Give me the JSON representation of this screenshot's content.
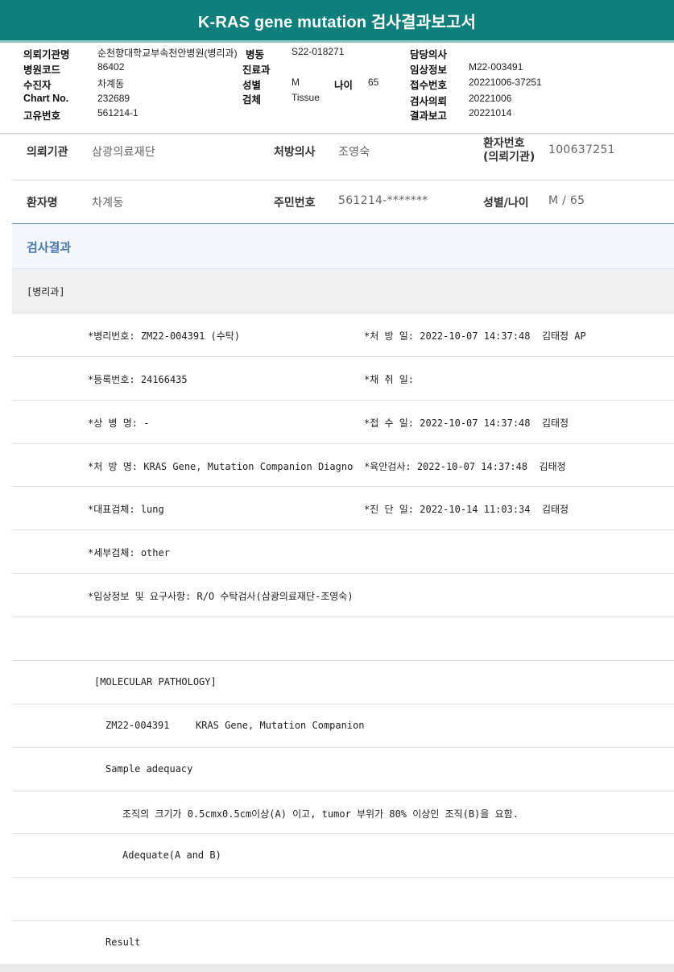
{
  "title": "K-RAS gene mutation 검사결과보고서",
  "header": {
    "org_label": "의뢰기관명",
    "org_value": "순천향대학교부속천안병원(병리과)",
    "hospital_code_label": "병원코드",
    "hospital_code_value": "86402",
    "patient_label": "수진자",
    "patient_value": "차계동",
    "chart_label": "Chart No.",
    "chart_value": "232689",
    "id_label": "고유번호",
    "id_value": "561214-1",
    "ward_label": "병동",
    "ward_value": "S22-018271",
    "dept_label": "진료과",
    "dept_value": "",
    "sex_label": "성별",
    "sex_value": "M",
    "age_label": "나이",
    "age_value": "65",
    "specimen_label": "검체",
    "specimen_value": "Tissue",
    "doctor_label": "담당의사",
    "doctor_value": "",
    "clinical_label": "임상정보",
    "clinical_value": "M22-003491",
    "receipt_label": "접수번호",
    "receipt_value": "20221006-37251",
    "request_label": "검사의뢰",
    "request_value": "20221006",
    "report_label": "결과보고",
    "report_value": "20221014"
  },
  "info": {
    "institution_label": "의뢰기관",
    "institution_value": "삼광의료재단",
    "prescriber_label": "처방의사",
    "prescriber_value": "조영숙",
    "patient_no_label": "환자번호\n(의뢰기관)",
    "patient_no_value": "100637251",
    "name_label": "환자명",
    "name_value": "차계동",
    "rrn_label": "주민번호",
    "rrn_value": "561214-*******",
    "sexage_label": "성별/나이",
    "sexage_value": "M / 65"
  },
  "section_title": "검사결과",
  "department": "[병리과]",
  "rows": [
    {
      "left": "*병리번호: ZM22-004391 (수탁)",
      "right": "*처 방 일: 2022-10-07 14:37:48  김태정 AP"
    },
    {
      "left": "*등록번호: 24166435",
      "right": "*채 취 일:"
    },
    {
      "left": "*상 병 명: -",
      "right": "*접 수 일: 2022-10-07 14:37:48  김태정"
    },
    {
      "left": "*처 방 명: KRAS Gene, Mutation Companion Diagno",
      "right": "*육안검사: 2022-10-07 14:37:48  김태정"
    },
    {
      "left": "*대표검체: lung",
      "right": "*진 단 일: 2022-10-14 11:03:34  김태정"
    },
    {
      "left": "*세부검체: other",
      "right": ""
    },
    {
      "left": "*임상정보 및 요구사항: R/O 수탁검사(삼광의료재단-조영숙)",
      "right": ""
    }
  ],
  "report": {
    "molecular": "[MOLECULAR PATHOLOGY]",
    "case_no": "ZM22-004391",
    "case_test": "KRAS Gene, Mutation Companion",
    "sample_adequacy": "Sample adequacy",
    "criteria": "조직의 크기가 0.5cmx0.5cm이상(A) 이고, tumor 부위가 80% 이상인 조직(B)을 요함.",
    "adequate": "Adequate(A and B)",
    "result": "Result"
  }
}
